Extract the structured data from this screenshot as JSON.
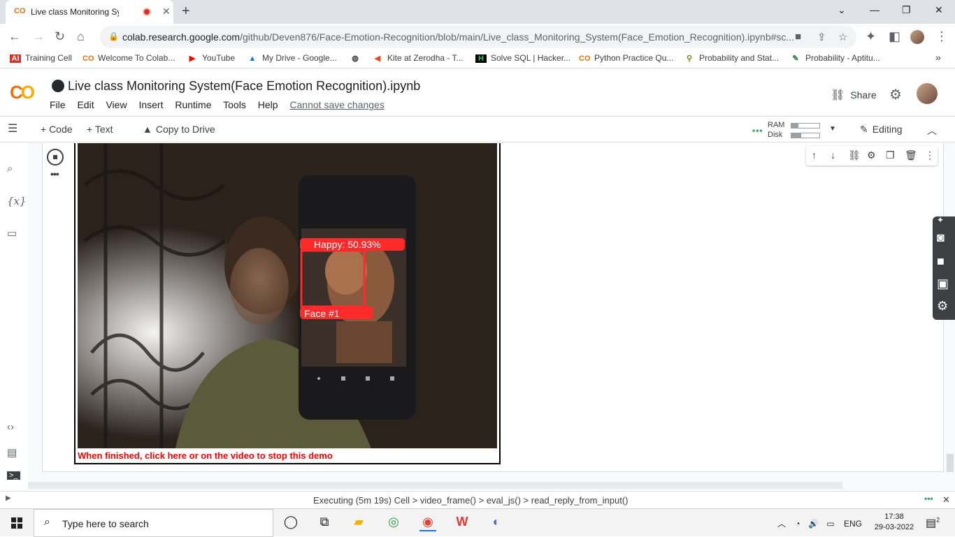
{
  "browser": {
    "tab_title": "Live class Monitoring System(Face_Emotion_Recognition).ipynb",
    "url_host": "colab.research.google.com",
    "url_path": "/github/Deven876/Face-Emotion-Recognition/blob/main/Live_class_Monitoring_System(Face_Emotion_Recognition).ipynb#sc...",
    "bookmarks": [
      {
        "label": "Training Cell",
        "icon": "AI"
      },
      {
        "label": "Welcome To Colab...",
        "icon": "CO"
      },
      {
        "label": "YouTube",
        "icon": "▶"
      },
      {
        "label": "My Drive - Google...",
        "icon": "▲"
      },
      {
        "label": "",
        "icon": "◍"
      },
      {
        "label": "Kite at Zerodha - T...",
        "icon": "◀"
      },
      {
        "label": "Solve SQL | Hacker...",
        "icon": "H"
      },
      {
        "label": "Python Practice Qu...",
        "icon": "CO"
      },
      {
        "label": "Probability and Stat...",
        "icon": "⚲"
      },
      {
        "label": "Probability - Aptitu...",
        "icon": "✎"
      }
    ],
    "overflow": "»"
  },
  "colab": {
    "logo": "CO",
    "notebook_title": "Live class Monitoring System(Face Emotion Recognition).ipynb",
    "menus": [
      "File",
      "Edit",
      "View",
      "Insert",
      "Runtime",
      "Tools",
      "Help"
    ],
    "cannot_save": "Cannot save changes",
    "share_label": "Share",
    "toolbar": {
      "code": "+ Code",
      "text": "+ Text",
      "copy_to_drive": "Copy to Drive",
      "ram": "RAM",
      "disk": "Disk",
      "ram_usage": 0.25,
      "disk_usage": 0.35,
      "editing": "Editing"
    },
    "sidebar_icons": [
      "list-icon",
      "search-icon",
      "variables-icon",
      "folder-icon",
      "code-icon",
      "form-icon",
      "terminal-icon"
    ],
    "variables_label": "{x}"
  },
  "video": {
    "emotion_label": "Happy: 50.93%",
    "face_label": "Face #1",
    "stop_message": "When finished, click here or on the video to stop this demo"
  },
  "status": {
    "text": "Executing (5m 19s)   Cell > video_frame() > eval_js() > read_reply_from_input()"
  },
  "taskbar": {
    "search_placeholder": "Type here to search",
    "lang": "ENG",
    "time": "17:38",
    "date": "29-03-2022",
    "notifications": "2"
  },
  "colors": {
    "accent_orange": "#e8710a",
    "accent_yellow": "#f9ab00",
    "detect_red": "#ff2a2a"
  }
}
